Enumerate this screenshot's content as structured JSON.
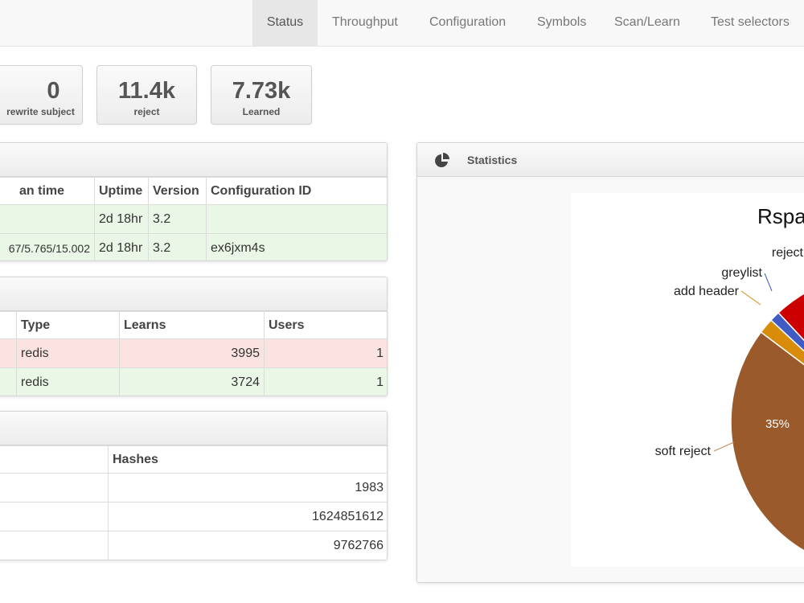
{
  "nav": {
    "tabs": [
      "Status",
      "Throughput",
      "Configuration",
      "Symbols",
      "Scan/Learn",
      "Test selectors"
    ],
    "active": "Status"
  },
  "widgets": [
    {
      "value": "0",
      "label": "rewrite subject"
    },
    {
      "value": "11.4k",
      "label": "reject"
    },
    {
      "value": "7.73k",
      "label": "Learned"
    }
  ],
  "servers_table": {
    "headers": [
      "an time",
      "Uptime",
      "Version",
      "Configuration ID"
    ],
    "rows": [
      [
        "",
        "2d 18hr",
        "3.2",
        ""
      ],
      [
        "67/5.765/15.002",
        "2d 18hr",
        "3.2",
        "ex6jxm4s"
      ]
    ]
  },
  "bayes_table": {
    "headers": [
      "",
      "Type",
      "Learns",
      "Users"
    ],
    "rows": [
      [
        "",
        "redis",
        "3995",
        "1"
      ],
      [
        "",
        "redis",
        "3724",
        "1"
      ]
    ]
  },
  "fuzzy_table": {
    "headers": [
      "",
      "Hashes"
    ],
    "rows": [
      [
        "",
        "1983"
      ],
      [
        "",
        "1624851612"
      ],
      [
        "",
        "9762766"
      ]
    ]
  },
  "statistics": {
    "title": "Statistics",
    "icon": "pie-chart-icon"
  },
  "chart_data": {
    "type": "pie",
    "title": "Rspa",
    "slices": [
      {
        "label": "soft reject",
        "value": 35,
        "color": "#9a5a2c"
      },
      {
        "label": "add header",
        "color": "#d98b0a"
      },
      {
        "label": "greylist",
        "color": "#3f5bc4"
      },
      {
        "label": "reject",
        "color": "#cc0000"
      }
    ],
    "data_labels": [
      "35%"
    ]
  }
}
